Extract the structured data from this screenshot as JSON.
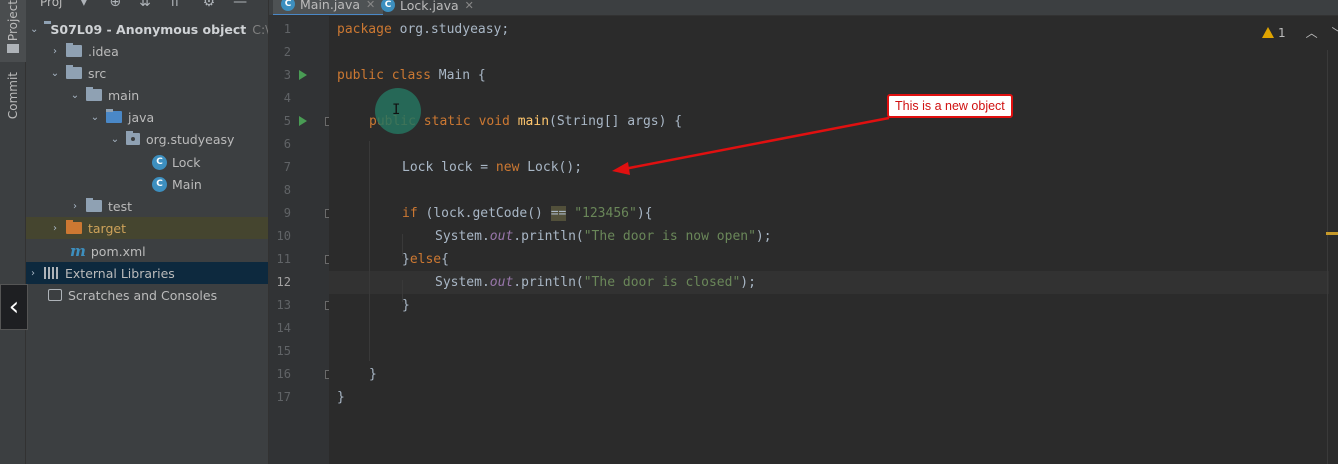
{
  "sidebar": {
    "project_tab": "Project",
    "commit_tab": "Commit"
  },
  "project_panel": {
    "title": "Proj",
    "tree": [
      {
        "label": "S07L09 - Anonymous object",
        "suffix": "C:\\Us"
      },
      {
        "label": ".idea"
      },
      {
        "label": "src"
      },
      {
        "label": "main"
      },
      {
        "label": "java"
      },
      {
        "label": "org.studyeasy"
      },
      {
        "label": "Lock",
        "icon_letter": "C"
      },
      {
        "label": "Main",
        "icon_letter": "C"
      },
      {
        "label": "test"
      },
      {
        "label": "target"
      },
      {
        "label": "pom.xml",
        "icon_letter": "m"
      },
      {
        "label": "External Libraries"
      },
      {
        "label": "Scratches and Consoles"
      }
    ]
  },
  "tabs": [
    {
      "label": "Main.java",
      "icon_letter": "C",
      "active": true
    },
    {
      "label": "Lock.java",
      "icon_letter": "C",
      "active": false
    }
  ],
  "line_numbers": [
    "1",
    "2",
    "3",
    "4",
    "5",
    "6",
    "7",
    "8",
    "9",
    "10",
    "11",
    "12",
    "13",
    "14",
    "15",
    "16",
    "17"
  ],
  "code": {
    "l1_kw": "package",
    "l1_rest": " org.studyeasy;",
    "l3_kw": "public class",
    "l3_rest": " Main {",
    "l5_kw1": "public static void",
    "l5_fn": " main",
    "l5_rest": "(String[] args) {",
    "l7_a": "Lock lock = ",
    "l7_kw": "new",
    "l7_b": " Lock();",
    "l9_kw": "if",
    "l9_a": " (lock.getCode() ",
    "l9_eq": "==",
    "l9_sp": " ",
    "l9_str": "\"123456\"",
    "l9_b": "){",
    "l10_a": "System.",
    "l10_st": "out",
    "l10_b": ".println(",
    "l10_str": "\"The door is now open\"",
    "l10_c": ");",
    "l11_a": "}",
    "l11_kw": "else",
    "l11_b": "{",
    "l12_a": "System.",
    "l12_st": "out",
    "l12_b": ".println(",
    "l12_str": "\"The door is closed\"",
    "l12_c": ");",
    "l13": "}",
    "l16": "}",
    "l17": "}"
  },
  "annotation": {
    "text": "This is a new object"
  },
  "inspections": {
    "warning_count": "1"
  },
  "colors": {
    "keyword": "#cc7832",
    "string": "#6a8759",
    "function": "#ffc66d",
    "annotation": "#e01010"
  }
}
